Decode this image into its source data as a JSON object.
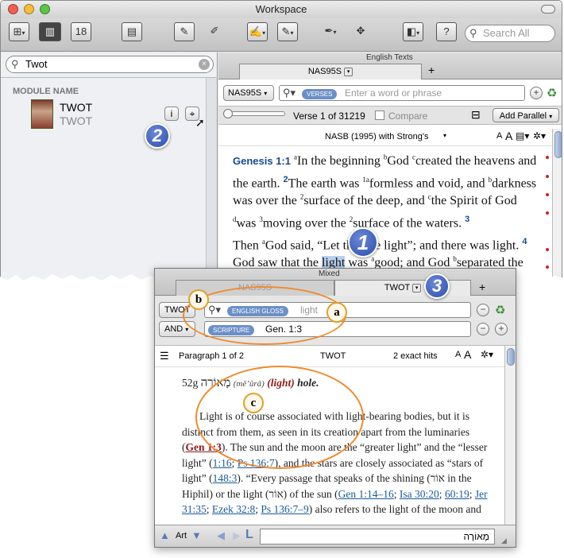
{
  "window": {
    "title": "Workspace"
  },
  "toolbar": {
    "search_placeholder": "Search All",
    "calendar_label": "18"
  },
  "library": {
    "search_value": "Twot",
    "header": "MODULE NAME",
    "module_name": "TWOT",
    "module_subname": "TWOT",
    "info_label": "i"
  },
  "texts_panel": {
    "group_label": "English Texts",
    "tab_label": "NAS95S",
    "add_tab": "+",
    "module_select": "NAS95S",
    "search_pill": "VERSES",
    "search_placeholder": "Enter a word or phrase",
    "verse_label": "Verse 1 of 31219",
    "compare_label": "Compare",
    "add_parallel": "Add Parallel",
    "version_title": "NASB (1995) with Strong's",
    "font_small": "A",
    "font_large": "A"
  },
  "passage": {
    "ref": "Genesis 1:1",
    "v1_a": "In the beginning ",
    "v1_b": "God ",
    "v1_c": "created the heavens and the earth.",
    "v2_num": "2",
    "v2_a": "The earth was ",
    "v2_b": "formless and void, and ",
    "v2_c": "darkness was over the ",
    "v2_d": "surface of the deep, and ",
    "v2_e": "the Spirit of God ",
    "v2_f": "was ",
    "v2_g": "moving over the ",
    "v2_h": "surface of the waters.",
    "v3_num": "3",
    "v3_a": "Then ",
    "v3_b": "God said, “Let th",
    "v3_c": "be light”; and there was light.",
    "v4_num": "4",
    "v4_a": "God saw that the ",
    "v4_hl": "light",
    "v4_b": " was ",
    "v4_c": "good; and God ",
    "v4_d": "separated the",
    "v4_e": "d the"
  },
  "popup": {
    "title": "Mixed",
    "tab1": "NAS95S",
    "tab2": "TWOT",
    "add_tab": "+",
    "module_btn": "TWOT",
    "gloss_pill": "ENGLISH GLOSS",
    "gloss_value": "light",
    "and_btn": "AND",
    "scripture_pill": "SCRIPTURE",
    "scripture_value": "Gen. 1:3",
    "paragraph_label": "Paragraph 1 of 2",
    "module_label": "TWOT",
    "hits_label": "2 exact hits",
    "entry_num": "52g",
    "entry_heb": "מָאוֹרָה",
    "entry_translit": "(mĕʼûrâ)",
    "entry_gloss": "(light)",
    "entry_tail": "hole.",
    "p1": "Light is of course associated with light-bearing bodies, but it is distinct from them, as seen in its creation apart from the luminaries (",
    "link_gen13": "Gen 1:3",
    "p2": "). The sun and the moon are the “greater light” and the “lesser light” (",
    "link_116": "1:16",
    "link_ps": "Ps 136:7",
    "p3": "), and the stars are closely associated as “stars of light” (",
    "link_148": "148:3",
    "p4": "). “Every passage that speaks of the shining (",
    "heb_or": "אוֹר",
    "p5": " in the Hiphil) or the light (",
    "heb_or2": "אוֹר",
    "p6": ") of the sun (",
    "link_gen114": "Gen 1:14–16",
    "link_isa": "Isa 30:20",
    "link_6019": "60:19",
    "link_jer": "Jer 31:35",
    "link_ezek": "Ezek 32:8",
    "link_ps2": "Ps 136:7–9",
    "p7": ") also refers to the light of the moon and",
    "bottom_art": "Art",
    "bottom_l": "L",
    "bottom_field": "מָאוֹרָה"
  },
  "callouts": {
    "n1": "1",
    "n2": "2",
    "n3": "3",
    "a": "a",
    "b": "b",
    "c": "c"
  }
}
